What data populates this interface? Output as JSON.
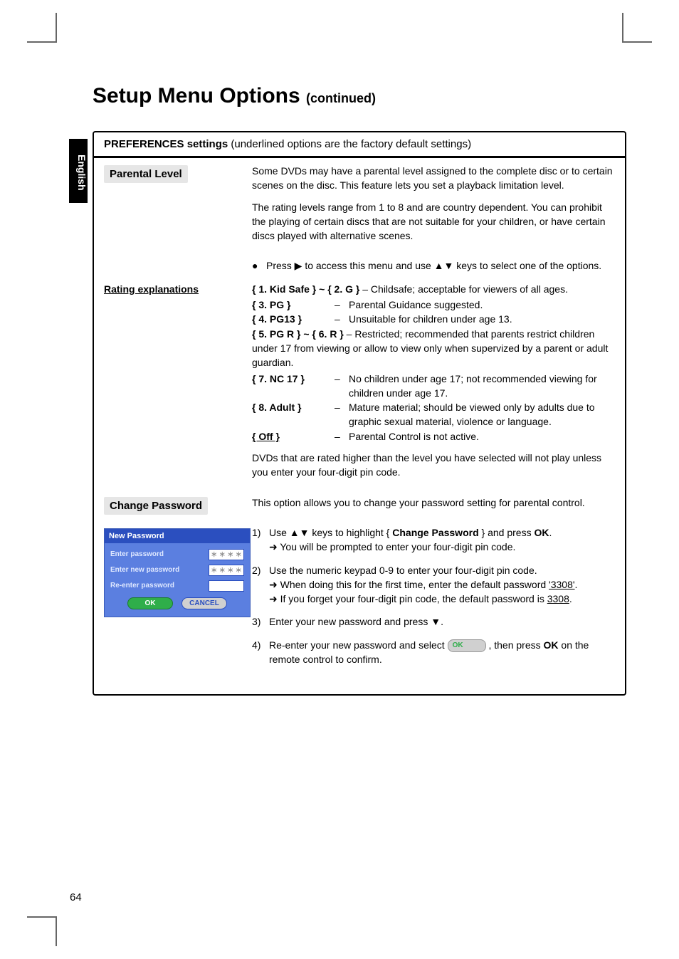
{
  "sideTab": "English",
  "title": "Setup Menu Options",
  "titleCont": "(continued)",
  "panelHeader": {
    "bold": "PREFERENCES settings",
    "rest": " (underlined options are the factory default settings)"
  },
  "parental": {
    "label": "Parental Level",
    "p1": "Some DVDs may have a parental level assigned to the complete disc or to certain scenes on the disc. This feature lets you set a playback limitation level.",
    "p2": "The rating levels range from 1 to 8 and are country dependent. You can prohibit the playing of certain discs that are not suitable for your children, or have certain discs played with alternative scenes.",
    "bullet": "Press ▶ to access this menu and use ▲▼ keys to select one of the options."
  },
  "ratingHead": "Rating explanations",
  "ratings": {
    "r1": {
      "k": "{ 1. Kid Safe } ~ { 2. G }",
      "sep": "–",
      "d": "Childsafe; acceptable for viewers of all ages."
    },
    "r2": {
      "k": "{ 3. PG }",
      "sep": "–",
      "d": "Parental Guidance suggested."
    },
    "r3": {
      "k": "{ 4. PG13 }",
      "sep": "–",
      "d": "Unsuitable for children under age 13."
    },
    "r4": {
      "k": "{ 5. PG R } ~ { 6. R }",
      "sep": "–",
      "d": "Restricted; recommended that parents restrict children under 17 from viewing or allow to view only when supervized by a parent or adult guardian."
    },
    "r5": {
      "k": "{ 7. NC 17 }",
      "sep": "–",
      "d": "No children under age 17; not recommended viewing for children under age 17."
    },
    "r6": {
      "k": "{ 8. Adult }",
      "sep": "–",
      "d": "Mature material; should be viewed only by adults due to graphic sexual material, violence or language."
    },
    "r7": {
      "k": "{ Off }",
      "sep": "–",
      "d": "Parental Control is not active."
    }
  },
  "ratingsNote": "DVDs that are rated higher than the level you have selected will not play unless you enter your four-digit pin code.",
  "change": {
    "label": "Change Password",
    "desc": "This option allows you to change your password setting for parental control.",
    "steps": {
      "s1a": "Use ▲▼ keys to highlight { ",
      "s1b": "Change Password",
      "s1c": " } and press ",
      "s1d": "OK",
      "s1e": ".",
      "s1f": "➜ You will be prompted to enter your four-digit pin code.",
      "s2a": "Use the numeric keypad 0-9 to enter your four-digit pin code.",
      "s2b": "➜ When doing this for the first time, enter the default password ",
      "s2c": "'3308'",
      "s2d": ".",
      "s2e": "➜ If you forget your four-digit pin code, the default password is ",
      "s2f": "3308",
      "s2g": ".",
      "s3": "Enter your new password and press ▼.",
      "s4a": "Re-enter your new password and select ",
      "s4b": "OK",
      "s4c": " , then press ",
      "s4d": "OK",
      "s4e": " on the remote control to confirm."
    }
  },
  "dialog": {
    "title": "New Password",
    "rows": {
      "r1": "Enter password",
      "r2": "Enter new password",
      "r3": "Re-enter password"
    },
    "stars": "＊ ＊ ＊ ＊",
    "ok": "OK",
    "cancel": "CANCEL"
  },
  "pageNum": "64"
}
